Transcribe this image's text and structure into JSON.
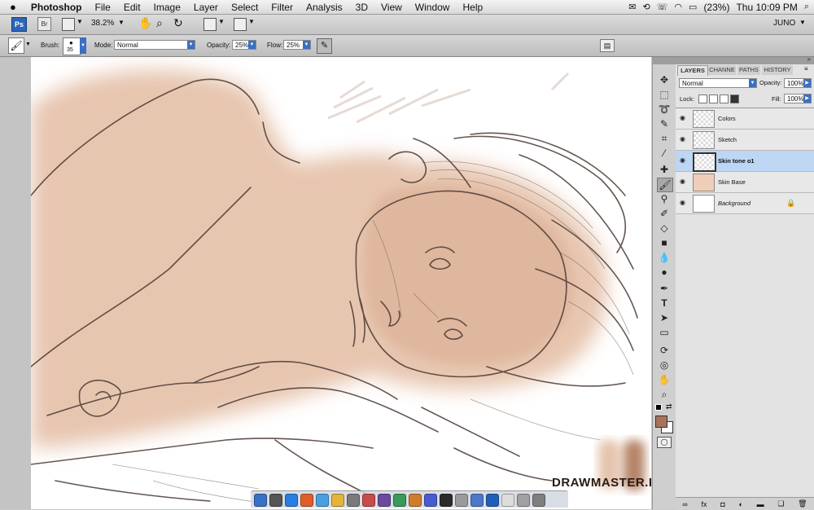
{
  "menubar": {
    "app_name": "Photoshop",
    "items": [
      "File",
      "Edit",
      "Image",
      "Layer",
      "Select",
      "Filter",
      "Analysis",
      "3D",
      "View",
      "Window",
      "Help"
    ],
    "battery": "(23%)",
    "clock": "Thu 10:09 PM"
  },
  "appbar": {
    "ps_badge": "Ps",
    "br_badge": "Br",
    "zoom": "38.2%",
    "workspace": "JUNO"
  },
  "options": {
    "brush_label": "Brush:",
    "brush_size": "35",
    "mode_label": "Mode:",
    "mode_value": "Normal",
    "opacity_label": "Opacity:",
    "opacity_value": "25%",
    "flow_label": "Flow:",
    "flow_value": "25%"
  },
  "panel": {
    "tabs": [
      "LAYERS",
      "CHANNE",
      "PATHS",
      "HISTORY"
    ],
    "blend_mode": "Normal",
    "opacity_label": "Opacity:",
    "opacity_value": "100%",
    "lock_label": "Lock:",
    "fill_label": "Fill:",
    "fill_value": "100%",
    "layers": [
      {
        "name": "Colors"
      },
      {
        "name": "Sketch"
      },
      {
        "name": "Skin tone o1"
      },
      {
        "name": "Skin Base"
      },
      {
        "name": "Background"
      }
    ]
  },
  "colors": {
    "foreground": "#a8735a",
    "skin": "#e6c3ac",
    "selection": "#bcd6f3"
  },
  "watermark": "DRAWMASTER.RU"
}
